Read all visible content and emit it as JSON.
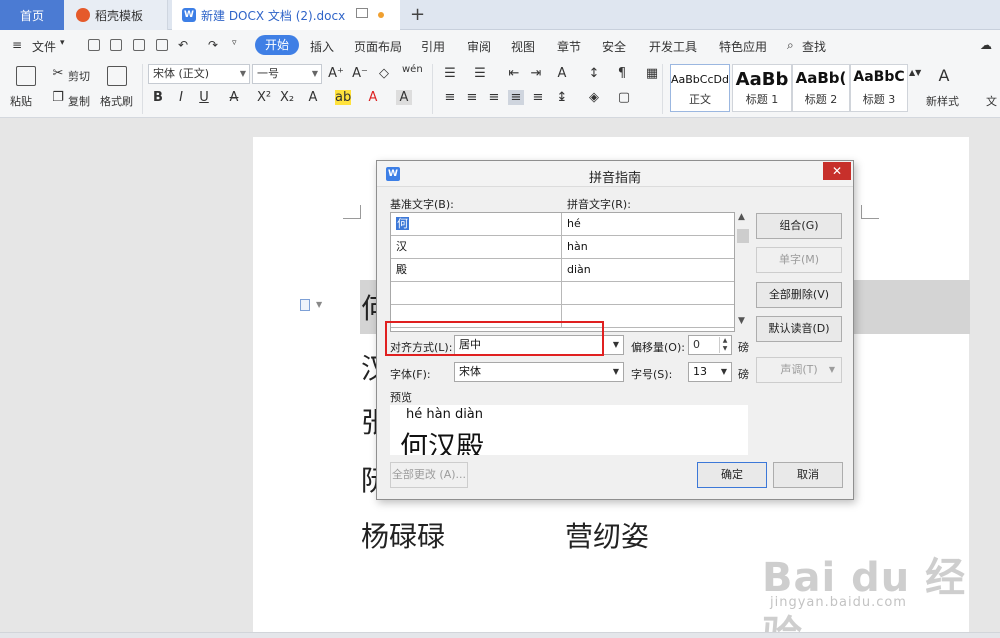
{
  "tabs": {
    "home": "首页",
    "daoke": "稻壳模板",
    "doc": "新建 DOCX 文档 (2).docx",
    "new_tab": "+"
  },
  "menu": {
    "file": "文件",
    "start": "开始",
    "items": [
      "插入",
      "页面布局",
      "引用",
      "审阅",
      "视图",
      "章节",
      "安全",
      "开发工具",
      "特色应用"
    ],
    "search": "查找"
  },
  "ribbon": {
    "paste": "粘贴",
    "cut": "剪切",
    "copy": "复制",
    "format_painter": "格式刷",
    "font_name": "宋体 (正文)",
    "font_size": "一号",
    "styles": [
      {
        "sample": "AaBbCcDd",
        "name": "正文"
      },
      {
        "sample": "AaBb",
        "name": "标题 1"
      },
      {
        "sample": "AaBb(",
        "name": "标题 2"
      },
      {
        "sample": "AaBbC",
        "name": "标题 3"
      }
    ],
    "new_style": "新样式",
    "text_tools": "文"
  },
  "document": {
    "lines": [
      "何",
      "汉",
      "张",
      "阮",
      "杨碌碌",
      "营纫姿"
    ]
  },
  "dialog": {
    "title": "拼音指南",
    "base_label": "基准文字(B):",
    "pinyin_label": "拼音文字(R):",
    "rows": [
      {
        "base": "何",
        "pinyin": "hé"
      },
      {
        "base": "汉",
        "pinyin": "hàn"
      },
      {
        "base": "殿",
        "pinyin": "diàn"
      }
    ],
    "buttons": {
      "combine": "组合(G)",
      "single": "单字(M)",
      "delete_all": "全部删除(V)",
      "default": "默认读音(D)",
      "tone": "声调(T)",
      "change_all": "全部更改 (A)...",
      "ok": "确定",
      "cancel": "取消"
    },
    "align_label": "对齐方式(L):",
    "align_value": "居中",
    "offset_label": "偏移量(O):",
    "offset_value": "0",
    "unit1": "磅",
    "font_label": "字体(F):",
    "font_value": "宋体",
    "size_label": "字号(S):",
    "size_value": "13",
    "unit2": "磅",
    "preview_label": "预览",
    "preview_pinyin": "hé  hàn diàn",
    "preview_text": "何汉殿"
  },
  "watermark": {
    "logo": "Bai du 经验",
    "url": "jingyan.baidu.com"
  }
}
